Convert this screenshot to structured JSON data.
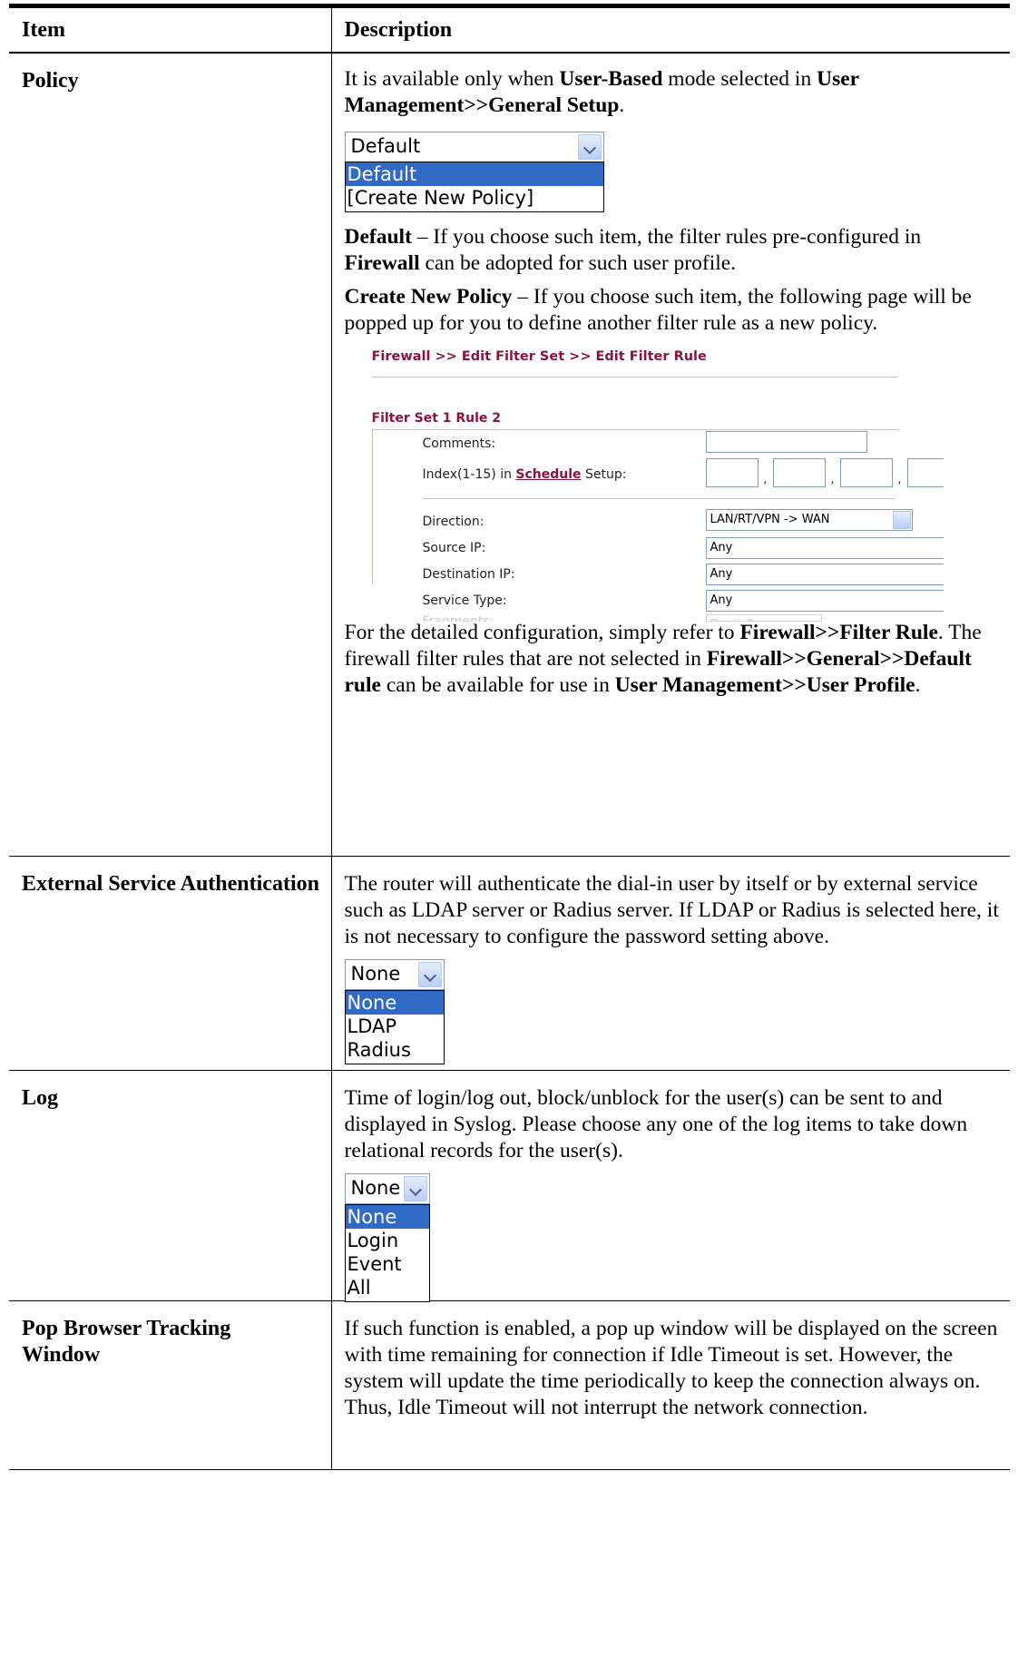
{
  "header": {
    "col_item": "Item",
    "col_description": "Description"
  },
  "rows": {
    "policy": {
      "item": "Policy",
      "p1_a": "It is available only when ",
      "p1_b": "User-Based",
      "p1_c": " mode selected in ",
      "p1_d": "User Management>>General Setup",
      "p1_e": ".",
      "dropdown": {
        "selected": "Default",
        "options": [
          "Default",
          "[Create New Policy]"
        ]
      },
      "p2_a": "Default",
      "p2_b": " – If you choose such item, the filter rules pre-configured in ",
      "p2_c": "Firewall",
      "p2_d": " can be adopted for such user profile.",
      "p3_a": "Create New Policy",
      "p3_b": " – If you choose such item, the following page will be popped up for you to define another filter rule as a new policy.",
      "firewall": {
        "title": "Firewall >> Edit Filter Set >> Edit Filter Rule",
        "set_title": "Filter Set 1 Rule 2",
        "comments_label": "Comments:",
        "index_label_a": "Index(1-15) in ",
        "index_label_link": "Schedule",
        "index_label_b": " Setup:",
        "direction_label": "Direction:",
        "direction_value": "LAN/RT/VPN -> WAN",
        "source_label": "Source IP:",
        "source_value": "Any",
        "dest_label": "Destination IP:",
        "dest_value": "Any",
        "service_label": "Service Type:",
        "service_value": "Any",
        "fragments_label": "Fragments:",
        "fragments_value": "Don't Care"
      },
      "p4_a": "For the detailed configuration, simply refer to ",
      "p4_b": "Firewall>>Filter Rule",
      "p4_c": ". The firewall filter rules that are not selected in ",
      "p4_d": "Firewall>>General>>Default rule",
      "p4_e": " can be available for use in ",
      "p4_f": "User Management>>User Profile",
      "p4_g": "."
    },
    "ext_auth": {
      "item": "External Service Authentication",
      "text": "The router will authenticate the dial-in user by itself or by external service such as LDAP server or Radius server. If LDAP or Radius is selected here, it is not necessary to configure the password setting above.",
      "dropdown": {
        "selected": "None",
        "options": [
          "None",
          "LDAP",
          "Radius"
        ]
      }
    },
    "log": {
      "item": "Log",
      "text": "Time of login/log out, block/unblock for the user(s) can be sent to and displayed in Syslog. Please choose any one of the log items to take down relational records for the user(s).",
      "dropdown": {
        "selected": "None",
        "options": [
          "None",
          "Login",
          "Event",
          "All"
        ]
      }
    },
    "pop": {
      "item": "Pop Browser Tracking Window",
      "text": "If such function is enabled, a pop up window will be displayed on the screen with time remaining for connection if Idle Timeout is set. However, the system will update the time periodically to keep the connection always on. Thus, Idle Timeout will not interrupt the network connection."
    }
  }
}
